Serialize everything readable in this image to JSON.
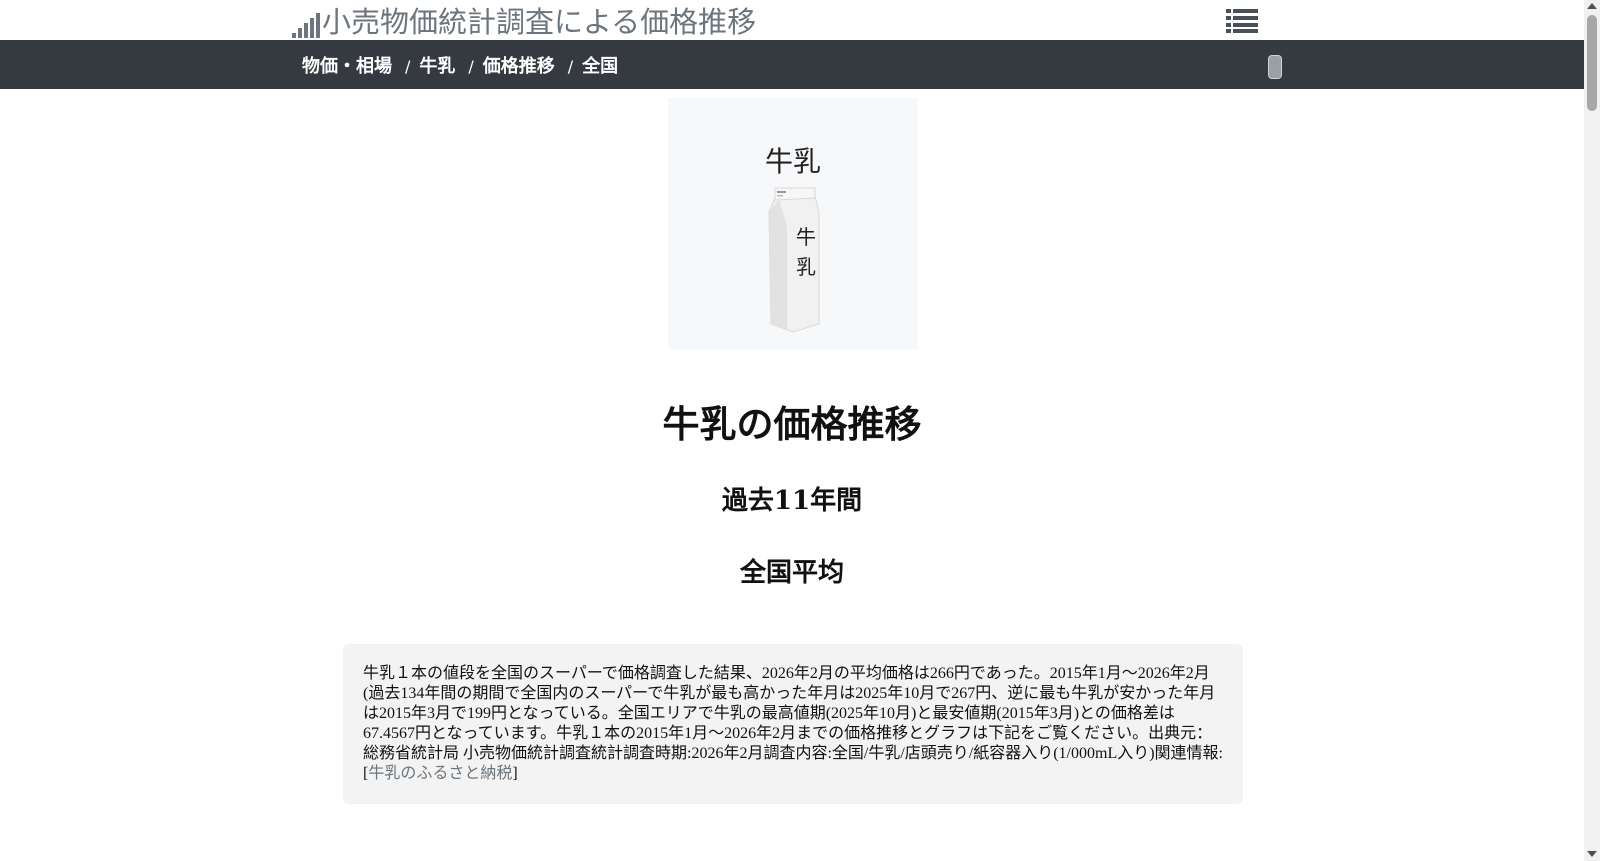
{
  "header": {
    "site_title": "小売物価統計調査による価格推移",
    "logo_icon": "signal-bars-icon",
    "menu_icon": "list-menu-icon"
  },
  "breadcrumb": {
    "items": [
      "物価・相場",
      "牛乳",
      "価格推移",
      "全国"
    ],
    "separator": "/"
  },
  "product": {
    "label": "牛乳",
    "carton_text": [
      "牛",
      "乳"
    ]
  },
  "titles": {
    "main": "牛乳の価格推移",
    "period": "過去11年間",
    "region": "全国平均"
  },
  "summary": {
    "text": "牛乳１本の値段を全国のスーパーで価格調査した結果、2026年2月の平均価格は266円であった。2015年1月～2026年2月(過去134年間の期間で全国内のスーパーで牛乳が最も高かった年月は2025年10月で267円、逆に最も牛乳が安かった年月は2015年3月で199円となっている。全国エリアで牛乳の最高値期(2025年10月)と最安値期(2015年3月)との価格差は67.4567円となっています。牛乳１本の2015年1月～2026年2月までの価格推移とグラフは下記をご覧ください。出典元：総務省統計局 小売物価統計調査統計調査時期:2026年2月調査内容:全国/牛乳/店頭売り/紙容器入り(1/000mL入り)関連情報:[",
    "link_text": "牛乳のふるさと納税",
    "text_end": "]"
  },
  "colors": {
    "navbar_bg": "#343a40",
    "title_gray": "#6c757d",
    "summary_bg": "#f3f3f3"
  }
}
